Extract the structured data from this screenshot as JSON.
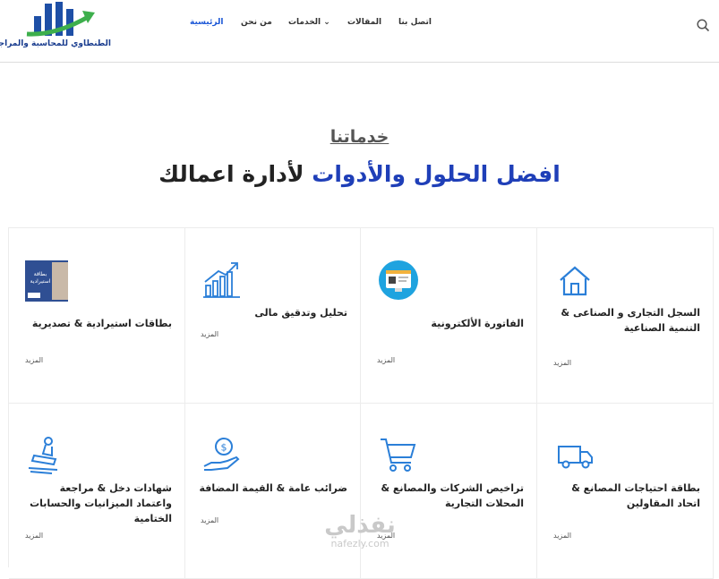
{
  "header": {
    "logo_text": "الطنطاوي للمحاسبة والمراجعة",
    "nav": {
      "home": "الرئيسية",
      "about": "من نحن",
      "services": "الخدمات",
      "articles": "المقالات",
      "contact": "اتصل بنا"
    }
  },
  "section": {
    "kicker": "خدماتنا",
    "title_highlight": "افضل الحلول والأدوات",
    "title_rest": "لأدارة اعمالك"
  },
  "cards": [
    {
      "title": "السجل التجارى و الصناعى & التنمية الصناعية",
      "more": "المزيد",
      "icon": "house-icon"
    },
    {
      "title": "الفاتورة الألكترونية",
      "more": "المزيد",
      "icon": "e-invoice-icon"
    },
    {
      "title": "تحليل وتدقيق مالى",
      "more": "المزيد",
      "icon": "growth-chart-icon"
    },
    {
      "title": "بطاقات استيرادية & تصديرية",
      "more": "المزيد",
      "icon": "import-card-photo"
    },
    {
      "title": "بطاقة احتياجات المصانع & اتحاد المقاولين",
      "more": "المزيد",
      "icon": "delivery-truck-icon"
    },
    {
      "title": "تراخيص الشركات والمصانع & المحلات التجارية",
      "more": "المزيد",
      "icon": "shopping-cart-icon"
    },
    {
      "title": "ضرائب عامة & القيمة المضافة",
      "more": "المزيد",
      "icon": "money-hand-icon"
    },
    {
      "title": "شهادات دخل & مراجعة واعتماد الميزانيات والحسابات الختامية",
      "more": "المزيد",
      "icon": "stamp-icon"
    }
  ],
  "import_card_caption": "بطاقة استيرادية",
  "watermark": {
    "arabic": "نفذلي",
    "latin": "nafezly.com"
  },
  "colors": {
    "accent": "#1a56d6",
    "title_highlight": "#1f3fb8",
    "icon_blue": "#2b7fd8",
    "logo_green": "#3daf4c"
  }
}
